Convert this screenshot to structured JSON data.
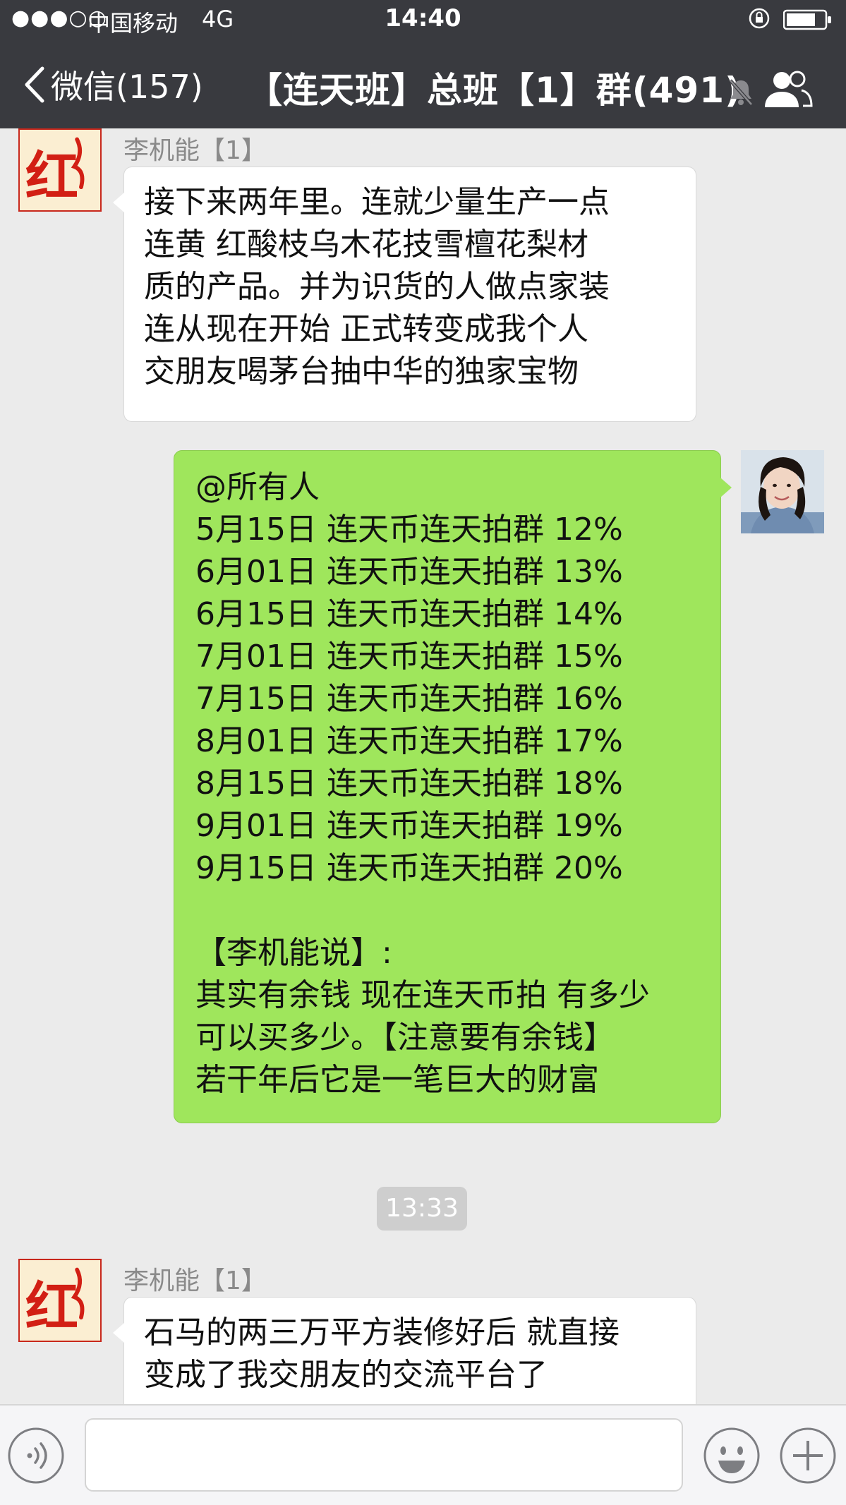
{
  "status_bar": {
    "signal": "●●●○○",
    "carrier": "中国移动",
    "network": "4G",
    "time": "14:40"
  },
  "nav": {
    "back_label": "微信(157)",
    "title": "【连天班】总班【1】群(491)"
  },
  "avatar_left_text": "红",
  "messages": [
    {
      "sender": "李机能【1】",
      "direction": "in",
      "text": "接下来两年里。连就少量生产一点\n 连黄 红酸枝乌木花技雪檀花梨材\n质的产品。并为识货的人做点家装\n  连从现在开始 正式转变成我个人\n交朋友喝茅台抽中华的独家宝物"
    },
    {
      "direction": "out",
      "text": "@所有人\n5月15日 连天币连天拍群 12%\n6月01日 连天币连天拍群 13%\n6月15日 连天币连天拍群 14%\n7月01日 连天币连天拍群 15%\n7月15日 连天币连天拍群 16%\n8月01日 连天币连天拍群 17%\n8月15日 连天币连天拍群 18%\n9月01日 连天币连天拍群 19%\n9月15日 连天币连天拍群 20%\n\n 【李机能说】:\n其实有余钱 现在连天币拍 有多少\n可以买多少。【注意要有余钱】\n若干年后它是一笔巨大的财富"
    },
    {
      "sender": "李机能【1】",
      "direction": "in",
      "text": "石马的两三万平方装修好后 就直接\n变成了我交朋友的交流平台了"
    }
  ],
  "time_divider": "13:33",
  "input": {
    "value": ""
  },
  "colors": {
    "topbar": "#393a3f",
    "background": "#ebebeb",
    "outgoing_bubble": "#9fe65c",
    "incoming_bubble": "#ffffff"
  },
  "icons": [
    "lock-rotation-icon",
    "battery-icon",
    "back-chevron-icon",
    "mute-icon",
    "group-members-icon",
    "voice-icon",
    "emoji-icon",
    "plus-icon"
  ]
}
